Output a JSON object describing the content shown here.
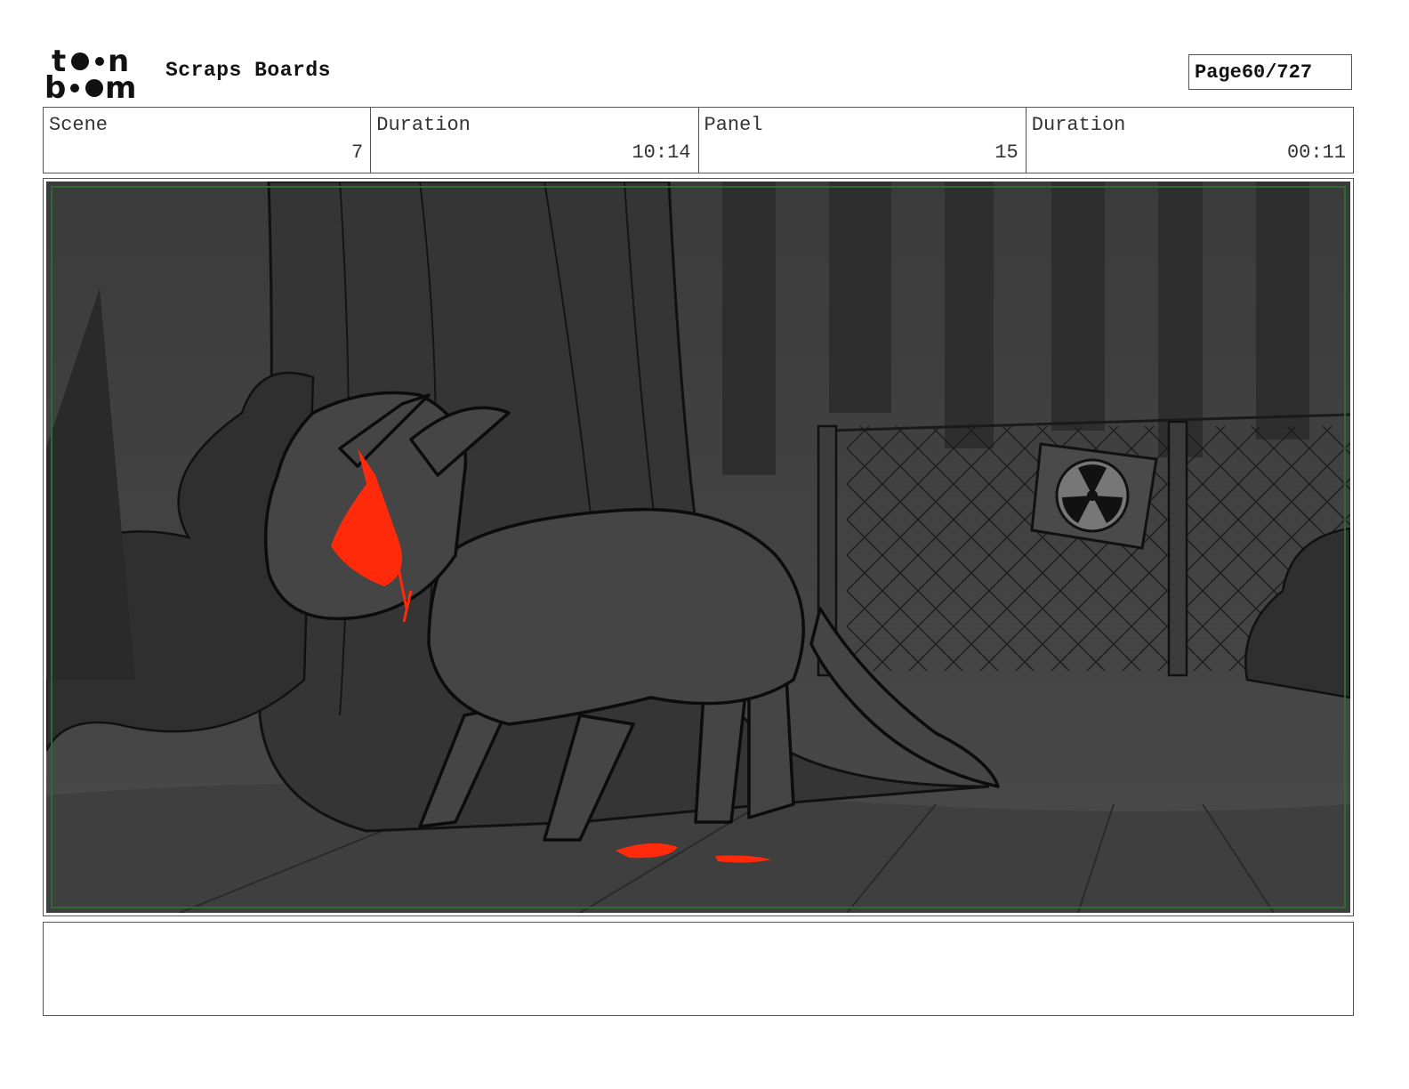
{
  "header": {
    "logo_text": "toon boom",
    "project_title": "Scraps Boards",
    "page_label": "Page",
    "page_number": "60/727"
  },
  "info": [
    {
      "label": "Scene",
      "value": "7"
    },
    {
      "label": "Duration",
      "value": "10:14"
    },
    {
      "label": "Panel",
      "value": "15"
    },
    {
      "label": "Duration",
      "value": "00:11"
    }
  ],
  "panel": {
    "description": "",
    "colors": {
      "background": "#3a3a3a",
      "accent": "#ff2a0a",
      "safe_frame": "#2f6b2f"
    }
  },
  "notes": {
    "text": ""
  }
}
